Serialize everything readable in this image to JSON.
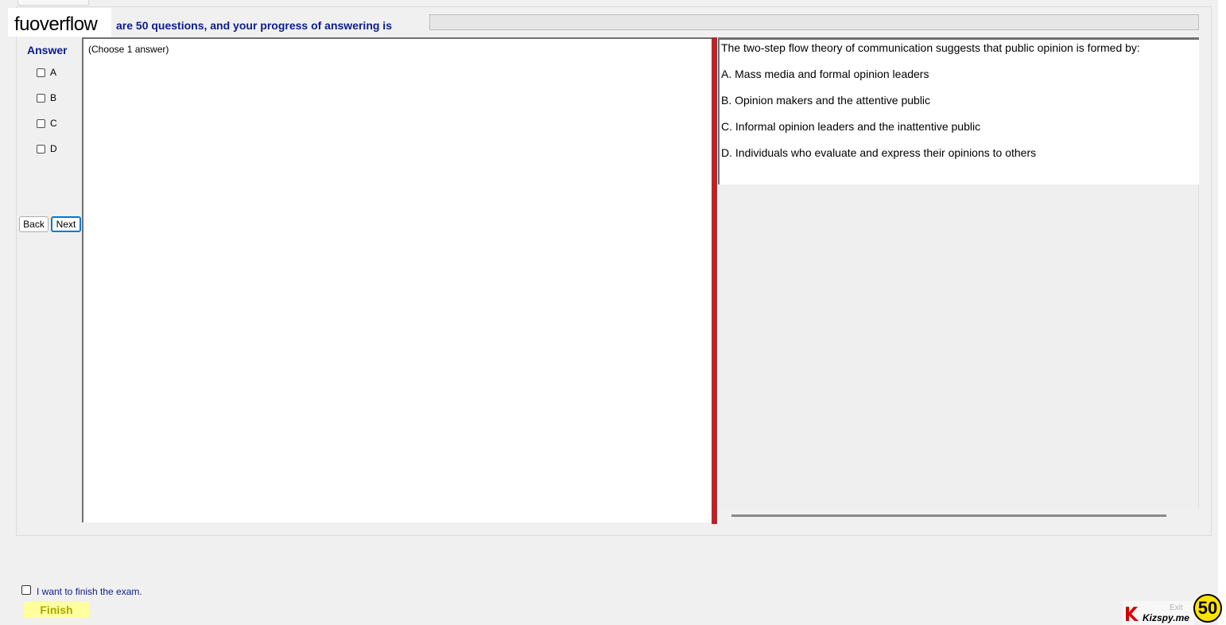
{
  "header": {
    "logo": "fuoverflow",
    "progress_text": "are 50 questions, and your progress of answering is",
    "progress_value": 0
  },
  "answer_panel": {
    "heading": "Answer",
    "options": [
      "A",
      "B",
      "C",
      "D"
    ]
  },
  "nav": {
    "back_label": "Back",
    "next_label": "Next"
  },
  "instruction": "(Choose 1 answer)",
  "question": {
    "stem": "The two-step flow theory of communication suggests that public opinion is formed by:",
    "choices": [
      "A.  Mass media and formal opinion leaders",
      "B.  Opinion makers and the attentive public",
      "C.  Informal opinion leaders and the inattentive public",
      "D.  Individuals who evaluate and express their opinions to others"
    ]
  },
  "footer": {
    "finish_checkbox_label": "I want to finish the exam.",
    "finish_label": "Finish",
    "exit_label": "Exit",
    "brand": "Kizspy.me",
    "count": "50"
  },
  "colors": {
    "accent_blue": "#0b1c8c",
    "splitter_red": "#e4111b",
    "finish_bg": "#ffff9e",
    "count_badge": "#ffe300"
  }
}
